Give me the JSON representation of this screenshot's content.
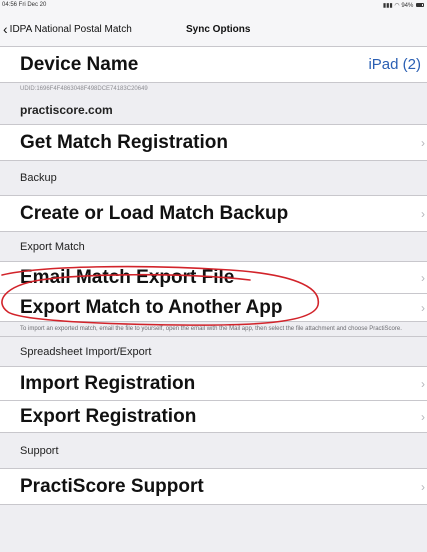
{
  "status_bar": {
    "time": "04:56  Fri Dec 20",
    "right": "94%"
  },
  "nav": {
    "back_label": "IDPA National Postal Match",
    "title": "Sync Options"
  },
  "device": {
    "label": "Device Name",
    "value": "iPad (2)",
    "udid": "UDID:1696F4F4863048F498DCE74183C20649"
  },
  "sections": {
    "practiscore": "practiscore.com",
    "backup": "Backup",
    "export_match": "Export Match",
    "spreadsheet": "Spreadsheet Import/Export",
    "support": "Support"
  },
  "rows": {
    "get_match_registration": "Get Match Registration",
    "create_load_backup": "Create or Load Match Backup",
    "email_match_export": "Email Match Export File",
    "export_to_app": "Export Match to Another App",
    "import_registration": "Import Registration",
    "export_registration": "Export Registration",
    "practiscore_support": "PractiScore Support"
  },
  "export_footnote": "To import an exported match, email the file to yourself, open the email with the Mail app, then select the file attachment and choose PractiScore.",
  "chevron_glyph": "›",
  "annotation_color": "#d2232a"
}
